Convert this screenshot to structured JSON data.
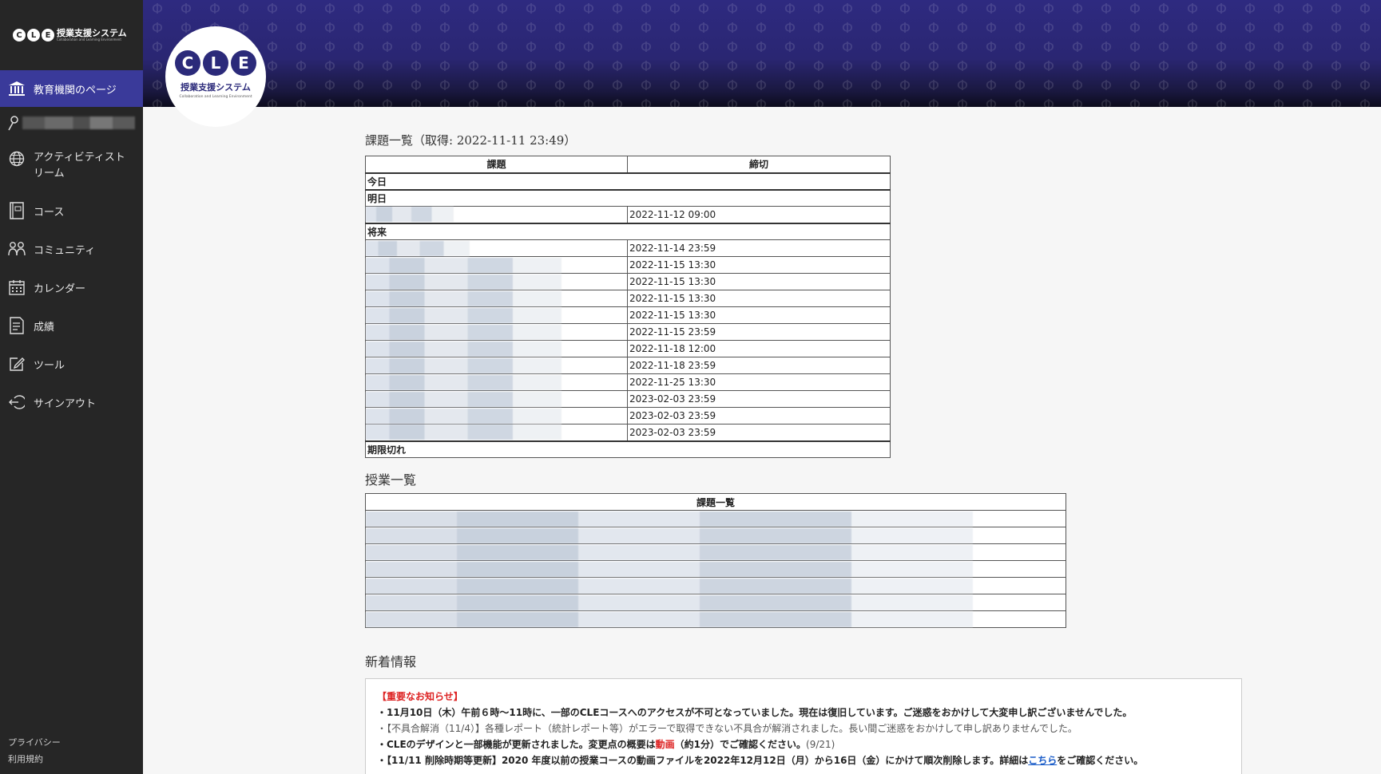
{
  "sidebar": {
    "logo_text": "授業支援システム",
    "logo_sub": "Collaboration and Learning Environment",
    "items": [
      {
        "label": "教育機関のページ",
        "icon": "institution-icon"
      },
      {
        "label": "",
        "icon": "user-icon"
      },
      {
        "label": "アクティビティストリーム",
        "icon": "globe-icon"
      },
      {
        "label": "コース",
        "icon": "course-icon"
      },
      {
        "label": "コミュニティ",
        "icon": "community-icon"
      },
      {
        "label": "カレンダー",
        "icon": "calendar-icon"
      },
      {
        "label": "成績",
        "icon": "grades-icon"
      },
      {
        "label": "ツール",
        "icon": "tools-icon"
      },
      {
        "label": "サインアウト",
        "icon": "signout-icon"
      }
    ],
    "footer": [
      "プライバシー",
      "利用規約"
    ]
  },
  "badge": {
    "letters": [
      "C",
      "L",
      "E"
    ],
    "jp": "授業支援システム",
    "en": "Collaboration and Learning Environment"
  },
  "assignments": {
    "title": "課題一覧（取得: 2022-11-11 23:49）",
    "headers": [
      "課題",
      "締切"
    ],
    "groups": {
      "today": "今日",
      "tomorrow": "明日",
      "future": "将来",
      "expired": "期限切れ"
    },
    "tomorrow_deadlines": [
      "2022-11-12 09:00"
    ],
    "future_deadlines": [
      "2022-11-14 23:59",
      "2022-11-15 13:30",
      "2022-11-15 13:30",
      "2022-11-15 13:30",
      "2022-11-15 13:30",
      "2022-11-15 23:59",
      "2022-11-18 12:00",
      "2022-11-18 23:59",
      "2022-11-25 13:30",
      "2023-02-03 23:59",
      "2023-02-03 23:59",
      "2023-02-03 23:59"
    ]
  },
  "courses": {
    "title": "授業一覧",
    "header": "課題一覧"
  },
  "news": {
    "title": "新着情報",
    "important": "【重要なお知らせ】",
    "line1": "・11月10日（木）午前６時〜11時に、一部のCLEコースへのアクセスが不可となっていました。現在は復旧しています。ご迷惑をおかけして大変申し訳ございませんでした。",
    "line2": "・【不具合解消（11/4）】各種レポート（統計レポート等）がエラーで取得できない不具合が解消されました。長い間ご迷惑をおかけして申し訳ありませんでした。",
    "line3_a": "・CLEのデザインと一部機能が更新されました。変更点の概要は",
    "line3_link": "動画",
    "line3_b": "（約1分）でご確認ください。",
    "line3_c": "(9/21)",
    "line4_a": "・【11/11 削除時期等更新】2020 年度以前の授業コースの動画ファイルを2022年12月12日（月）から16日（金）にかけて順次削除します。詳細は",
    "line4_link": "こちら",
    "line4_b": "をご確認ください。"
  }
}
